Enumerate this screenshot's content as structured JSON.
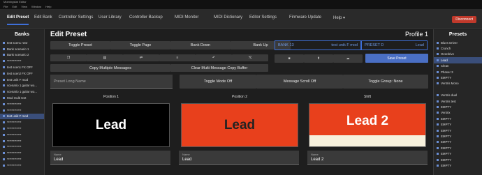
{
  "window": {
    "title": "Morningstar Editor"
  },
  "menu": [
    "File",
    "Edit",
    "View",
    "Window",
    "Help"
  ],
  "tabs": [
    {
      "label": "Edit Preset",
      "active": true
    },
    {
      "label": "Edit Bank"
    },
    {
      "label": "Controller Settings"
    },
    {
      "label": "User Library"
    },
    {
      "label": "Controller Backup"
    },
    {
      "label": "MIDI Monitor"
    },
    {
      "label": "MIDI Dictionary"
    },
    {
      "label": "Editor Settings"
    },
    {
      "label": "Firmware Update"
    },
    {
      "label": "Help ▾"
    }
  ],
  "disconnect_label": "Disconnect",
  "banks": {
    "title": "Banks",
    "items": [
      "test scen1 new",
      "Bank scenario 1",
      "Bank scenario 2",
      "************",
      "test scen1 FX OFF",
      "test scen2 FX OFF",
      "test unik F mod",
      "scenario 1 guitar wo...",
      "scenario 1 guitar wo...",
      "Mod multi test",
      "************",
      "************",
      "test unik F mod",
      "************",
      "************",
      "************",
      "************",
      "************",
      "************",
      "************",
      "************"
    ],
    "selected_index": 12
  },
  "editor": {
    "title": "Edit Preset",
    "profile": "Profile 1",
    "toggle_preset": "Toggle Preset",
    "toggle_page": "Toggle Page",
    "bank_down": "Bank Down",
    "bank_up": "Bank Up",
    "bank_label": "BANK 13",
    "bank_name": "test unik F mod",
    "preset_label": "PRESET D",
    "preset_name": "Lead",
    "save_preset": "Save Preset",
    "copy_multiple": "Copy Multiple Messages",
    "clear_buffer": "Clear Multi Message Copy Buffer",
    "long_name_placeholder": "Preset Long Name",
    "toggle_mode": "Toggle Mode Off",
    "msg_scroll": "Message Scroll Off",
    "toggle_group": "Toggle Group: None",
    "positions": [
      {
        "label": "Position 1",
        "display": "Lead",
        "name_label": "Name",
        "name": "Lead"
      },
      {
        "label": "Position 2",
        "display": "Lead",
        "name_label": "Name",
        "name": "Lead"
      },
      {
        "label": "Shift",
        "display": "Lead 2",
        "name_label": "Name",
        "name": "Lead 2"
      }
    ]
  },
  "presets": {
    "title": "Presets",
    "items": [
      "Blues Driver",
      "Crunch",
      "Overdrive",
      "Lead",
      "Clean",
      "Phaser 3",
      "EMPTY",
      "Ventris Mono",
      "",
      "Ventris dual",
      "Ventris test",
      "EMPTY",
      "Ventrix",
      "EMPTY",
      "EMPTY",
      "EMPTY",
      "EMPTY",
      "EMPTY",
      "EMPTY",
      "EMPTY",
      "EMPTY",
      "EMPTY"
    ],
    "letters": [
      "A",
      "B",
      "C",
      "D",
      "E",
      "F",
      "G",
      "H",
      "",
      "I",
      "J",
      "K",
      "L",
      "M",
      "N",
      "O",
      "P",
      "Q",
      "R",
      "S",
      "T",
      "U"
    ],
    "selected_index": 3
  }
}
